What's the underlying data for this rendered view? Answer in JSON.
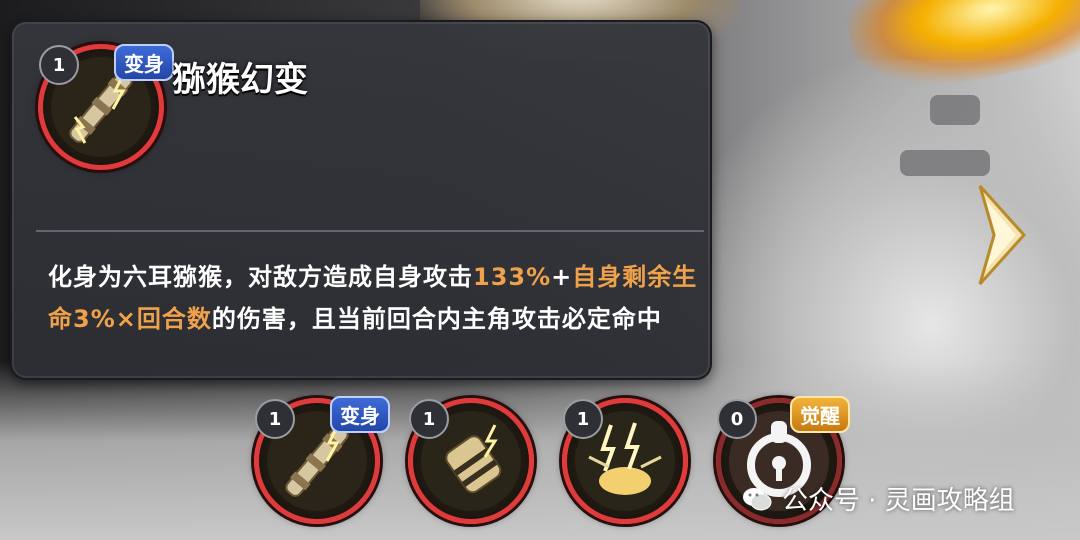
{
  "tooltip": {
    "level": "1",
    "tag": "变身",
    "title": "猕猴幻变",
    "description": {
      "p1": "化身为六耳猕猴，对敌方造成自身攻击",
      "p2": "133%",
      "p3": "+",
      "p4": "自身剩余生命3%×回合数",
      "p5": "的伤害，且当前回合内主角攻击必定命中"
    }
  },
  "skills": [
    {
      "level": "1",
      "tag": "变身",
      "icon": "staff-lightning-icon"
    },
    {
      "level": "1",
      "tag": "",
      "icon": "gauntlet-lightning-icon"
    },
    {
      "level": "1",
      "tag": "",
      "icon": "lightning-burst-icon"
    },
    {
      "level": "0",
      "tag": "觉醒",
      "icon": "lock-icon"
    }
  ],
  "watermark": "公众号 · 灵画攻略组",
  "colors": {
    "highlight": "#f0a24a",
    "ring": "#e03a3a",
    "tag_blue": "#2f55c0",
    "tag_gold": "#e09a20"
  }
}
